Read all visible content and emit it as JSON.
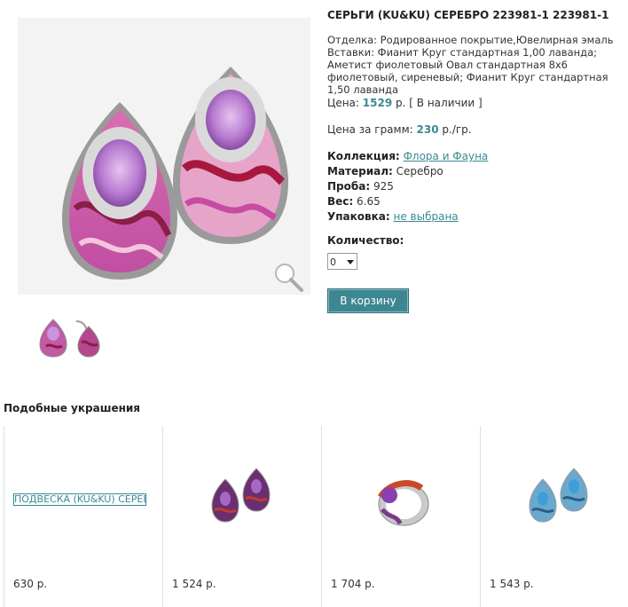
{
  "product": {
    "title": "СЕРЬГИ (KU&KU) СЕРЕБРО 223981-1 223981-1",
    "description": "Отделка: Родированное покрытие,Ювелирная эмаль Вставки: Фианит Круг стандартная 1,00 лаванда; Аметист фиолетовый Овал стандартная 8x6 фиолетовый, сиреневый; Фианит Круг стандартная 1,50 лаванда",
    "price_label": "Цена:",
    "price_value": "1529",
    "price_unit": "р.",
    "availability": "[ В наличии ]",
    "gram_label": "Цена за грамм:",
    "gram_value": "230",
    "gram_unit": "р./гр.",
    "collection_label": "Коллекция:",
    "collection_value": "Флора и Фауна",
    "material_label": "Материал:",
    "material_value": "Серебро",
    "probe_label": "Проба:",
    "probe_value": "925",
    "weight_label": "Вес:",
    "weight_value": "6.65",
    "package_label": "Упаковка:",
    "package_value": "не выбрана",
    "quantity_label": "Количество:",
    "quantity_value": "0",
    "cart_button": "В корзину"
  },
  "similar": {
    "title": "Подобные украшения",
    "items": [
      {
        "alt": "ПОДВЕСКА (KU&KU) СЕРЕБРО",
        "price": "630 р."
      },
      {
        "price": "1 524 р."
      },
      {
        "price": "1 704 р."
      },
      {
        "price": "1 543 р."
      }
    ]
  },
  "colors": {
    "accent": "#3a8a93",
    "button": "#3c8791"
  },
  "icons": [
    "zoom-icon"
  ]
}
